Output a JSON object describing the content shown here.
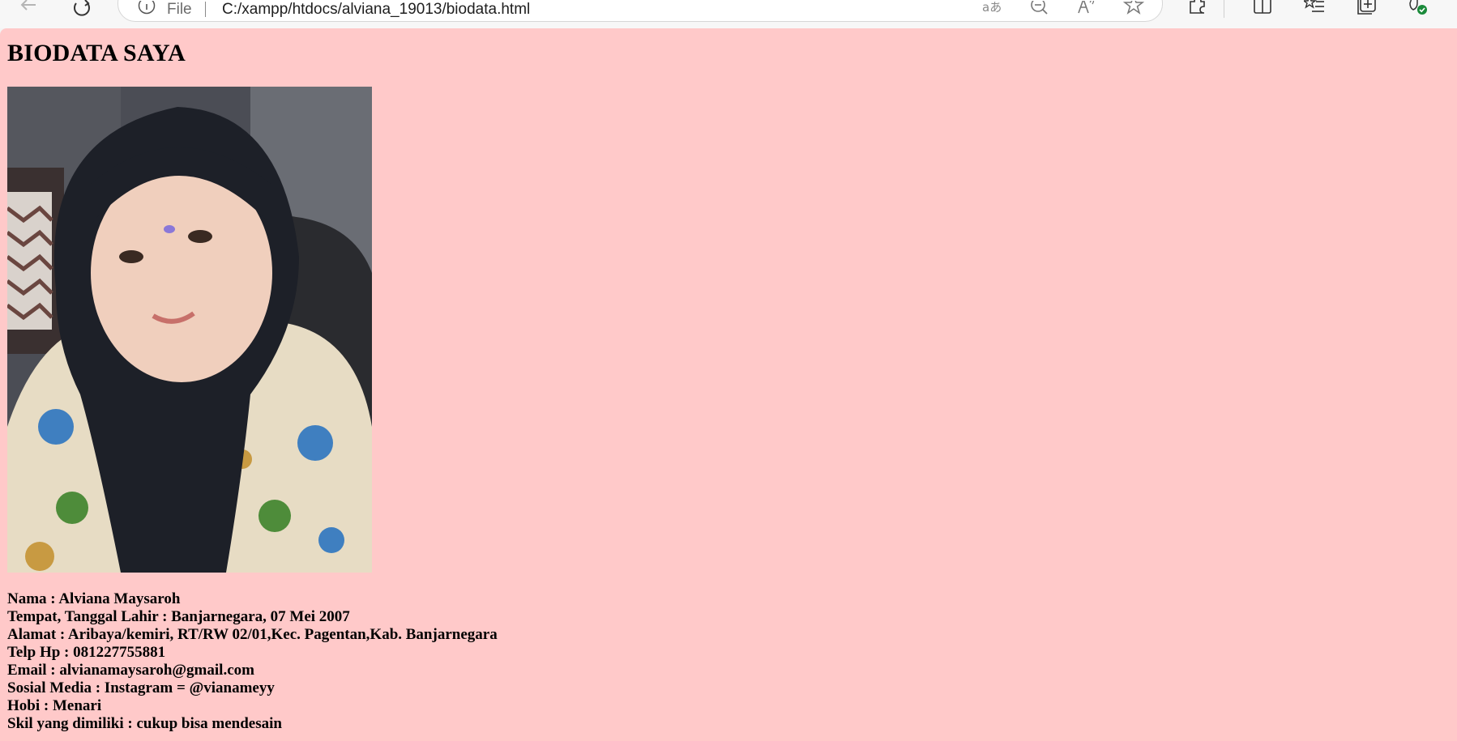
{
  "browser": {
    "address_scheme": "File",
    "address_url": "C:/xampp/htdocs/alviana_19013/biodata.html",
    "icons": {
      "back": "back-arrow-icon",
      "reload": "reload-icon",
      "site_info": "info-icon",
      "translate": "translate-icon",
      "zoom_out": "zoom-out-icon",
      "read_aloud": "read-aloud-icon",
      "favorite": "star-icon",
      "extensions": "puzzle-icon",
      "split_screen": "split-screen-icon",
      "favorites": "favorites-list-icon",
      "collections": "collections-icon",
      "profile_status": "browser-essentials-icon"
    }
  },
  "page": {
    "background": "#ffc9c9",
    "title": "BIODATA SAYA",
    "photo": "profile-photo",
    "details": [
      "Nama : Alviana Maysaroh",
      "Tempat, Tanggal Lahir : Banjarnegara, 07 Mei 2007",
      "Alamat : Aribaya/kemiri, RT/RW 02/01,Kec. Pagentan,Kab. Banjarnegara",
      "Telp Hp : 081227755881",
      "Email : alvianamaysaroh@gmail.com",
      "Sosial Media : Instagram = @vianameyy",
      "Hobi : Menari",
      "Skil yang dimiliki : cukup bisa mendesain"
    ]
  }
}
